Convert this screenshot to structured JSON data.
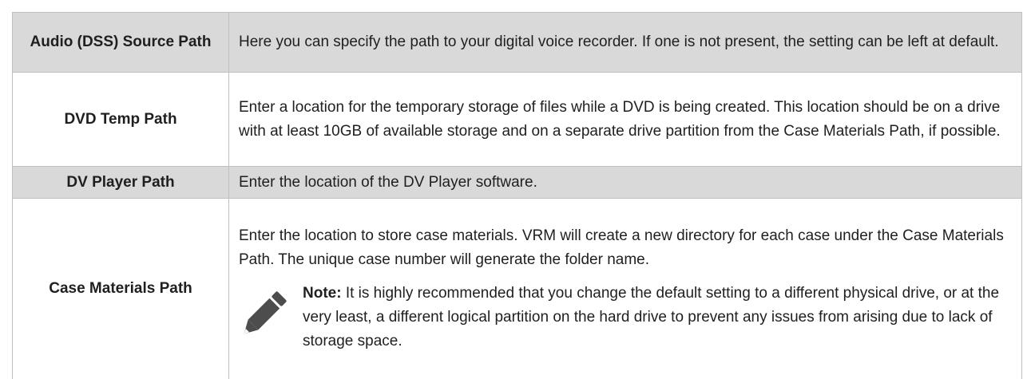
{
  "rows": [
    {
      "label": "Audio (DSS) Source Path",
      "description": "Here you can specify the path to your digital voice recorder. If one is not present, the setting can be left at default."
    },
    {
      "label": "DVD Temp Path",
      "description": "Enter a location for the temporary storage of files while a DVD is being created. This location should be on a drive with at least 10GB of available storage and on a separate drive partition from the Case Materials Path, if possible."
    },
    {
      "label": "DV Player Path",
      "description": "Enter the location of the DV Player software."
    },
    {
      "label": "Case Materials Path",
      "description": "Enter the location to store case materials. VRM will create a new directory for each case under the Case Materials Path. The unique case number will generate the folder name.",
      "note_label": "Note:",
      "note_text": " It is highly recommended that you change the default setting to a different physical drive, or at the very least, a different logical partition on the hard drive to prevent any issues from arising due to lack of storage space.",
      "note_icon": "pencil-icon"
    }
  ],
  "colors": {
    "shaded_row": "#d9d9d9",
    "border": "#bfbfbf",
    "icon": "#4d4d4d"
  }
}
